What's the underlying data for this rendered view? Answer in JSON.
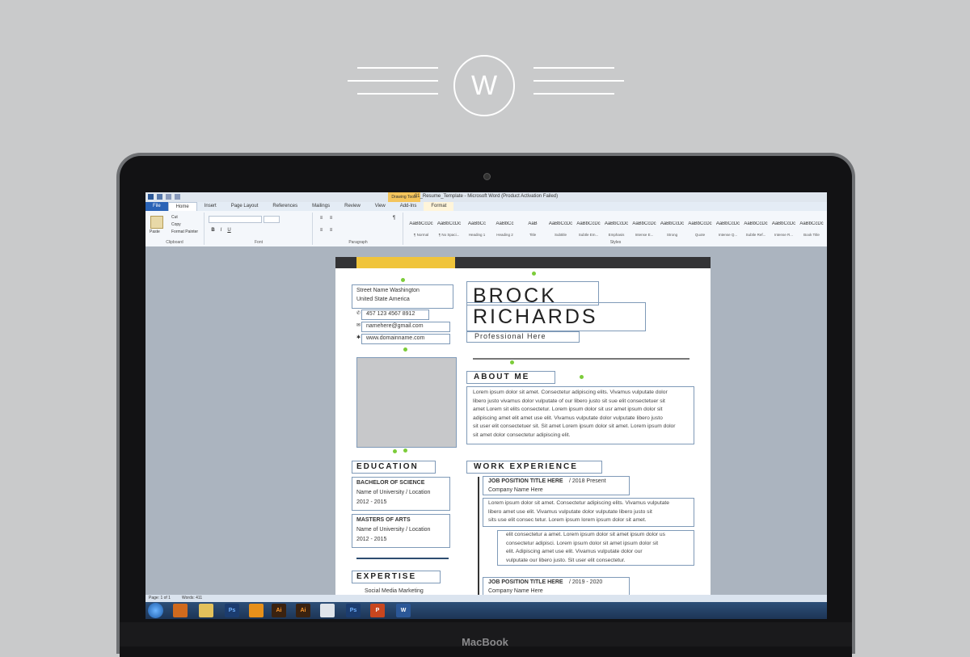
{
  "logo": {
    "letter": "W"
  },
  "device": {
    "brand": "MacBook"
  },
  "word": {
    "window_title": "01_Resume_Template - Microsoft Word (Product Activation Failed)",
    "contextual_tab": "Drawing Tools",
    "tabs": [
      "File",
      "Home",
      "Insert",
      "Page Layout",
      "References",
      "Mailings",
      "Review",
      "View",
      "Add-Ins",
      "Format"
    ],
    "ribbon": {
      "paste": "Paste",
      "cut": "Cut",
      "copy": "Copy",
      "format_painter": "Format Painter",
      "clipboard": "Clipboard",
      "font": "Font",
      "paragraph": "Paragraph",
      "styles": "Styles",
      "bold": "B",
      "italic": "I",
      "underline": "U",
      "pilcrow": "¶",
      "style_items": [
        {
          "sample": "AaBbCcDc",
          "name": "¶ Normal"
        },
        {
          "sample": "AaBbCcDc",
          "name": "¶ No Spaci..."
        },
        {
          "sample": "AaBbCc",
          "name": "Heading 1"
        },
        {
          "sample": "AaBbCc",
          "name": "Heading 2"
        },
        {
          "sample": "AaB",
          "name": "Title"
        },
        {
          "sample": "AaBbCcDc",
          "name": "Subtitle"
        },
        {
          "sample": "AaBbCcDc",
          "name": "Subtle Em..."
        },
        {
          "sample": "AaBbCcDc",
          "name": "Emphasis"
        },
        {
          "sample": "AaBbCcDc",
          "name": "Intense E..."
        },
        {
          "sample": "AaBbCcDc",
          "name": "Strong"
        },
        {
          "sample": "AaBbCcDc",
          "name": "Quote"
        },
        {
          "sample": "AaBbCcDc",
          "name": "Intense Q..."
        },
        {
          "sample": "AaBbCcDc",
          "name": "Subtle Ref..."
        },
        {
          "sample": "AaBbCcDc",
          "name": "Intense R..."
        },
        {
          "sample": "AaBbCcDc",
          "name": "Book Title"
        }
      ]
    },
    "status": {
      "page": "Page: 1 of 1",
      "words": "Words: 411"
    }
  },
  "resume": {
    "address1": "Street Name Washington",
    "address2": "United State America",
    "phone": "457 123 4567 8912",
    "email": "namehere@gmail.com",
    "website": "www.domainname.com",
    "first_name": "BROCK",
    "last_name": "RICHARDS",
    "profession": "Professional Here",
    "about_heading": "ABOUT ME",
    "about_lines": [
      "Lorem ipsum dolor sit amet. Consectetur adipiscing elits. Vivamus vulputate dolor",
      "libero justo vivamus dolor vulputate of our libero justo sit sue elit consectetuer sit",
      "amet Lorem sit elits consectetur.  Lorem ipsum dolor sit usr amet ipsum dolor sit",
      "adipiscing amet elit amet use elit. Vivamus vulputate dolor vulputate  libero justo",
      "sit user elit consectetuer sit. Sit amet Lorem ipsum dolor sit amet. Lorem ipsum dolor",
      "sit amet dolor consectetur adipiscing elit."
    ],
    "education_heading": "EDUCATION",
    "edu1_title": "BACHELOR OF SCIENCE",
    "edu1_school": "Name of University / Location",
    "edu1_years": "2012 - 2015",
    "edu2_title": "MASTERS OF ARTS",
    "edu2_school": "Name of University / Location",
    "edu2_years": "2012 - 2015",
    "expertise_heading": "EXPERTISE",
    "expertise1": "Social Media Marketing",
    "work_heading": "WORK EXPERIENCE",
    "job1_title": "JOB POSITION TITLE HERE",
    "job1_dates": "/ 2018 Present",
    "job1_company": "Company Name Here",
    "job1_lines": [
      "Lorem ipsum dolor sit amet. Consectetur adipiscing elits. Vivamus vulputate",
      "libero amet use elit. Vivamus vulputate dolor vulputate libero justo sit",
      "sits use elit consec tetur. Lorem ipsum lorem ipsum dolor sit amet."
    ],
    "job1_bullets": [
      "elit consectetur a amet. Lorem ipsum dolor sit amet ipsum dolor us",
      "consectetur adipisci. Lorem ipsum dolor sit amet ipsum dolor sit",
      "elit. Adipiscing amet use elit. Vivamus vulputate dolor our",
      "vulputate our libero justo. Sit user elit consectetur."
    ],
    "job2_title": "JOB POSITION TITLE HERE",
    "job2_dates": "/ 2019 - 2020",
    "job2_company": "Company Name Here"
  },
  "colors": {
    "accent": "#f0c43a",
    "page_header": "#333335",
    "selection": "#7f9ab8"
  }
}
